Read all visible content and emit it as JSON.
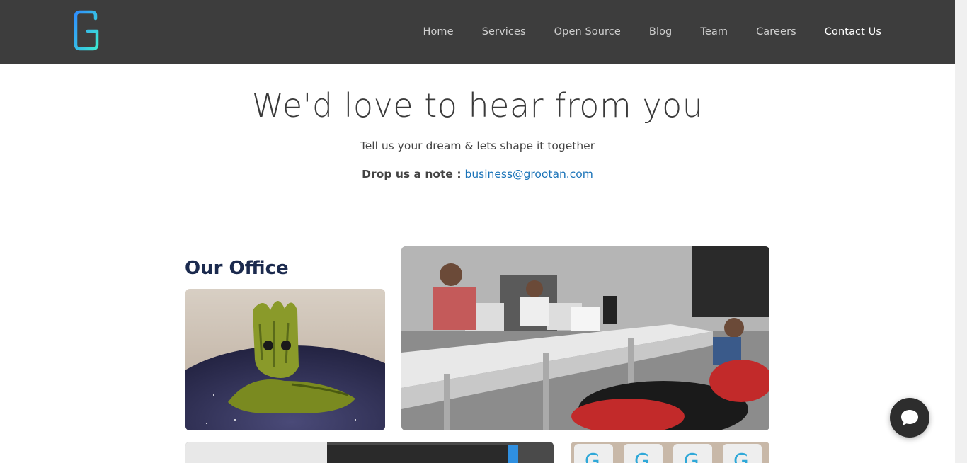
{
  "navbar": {
    "logo_icon": "grootan-g-logo",
    "links": [
      {
        "label": "Home"
      },
      {
        "label": "Services"
      },
      {
        "label": "Open Source"
      },
      {
        "label": "Blog"
      },
      {
        "label": "Team"
      },
      {
        "label": "Careers"
      },
      {
        "label": "Contact Us",
        "active": true
      }
    ]
  },
  "hero": {
    "title": "We'd love to hear from you",
    "subtitle": "Tell us your dream & lets shape it together",
    "note_label": "Drop us a note :",
    "email": "business@grootan.com"
  },
  "office": {
    "title": "Our Office"
  },
  "chat": {
    "icon": "chat-bubble-icon"
  },
  "colors": {
    "navbar_bg": "#3d3d3d",
    "link_color": "#1a73b8",
    "heading_dark": "#1b2a4e",
    "logo_gradient": [
      "#2fa8ff",
      "#3de0d0"
    ]
  }
}
